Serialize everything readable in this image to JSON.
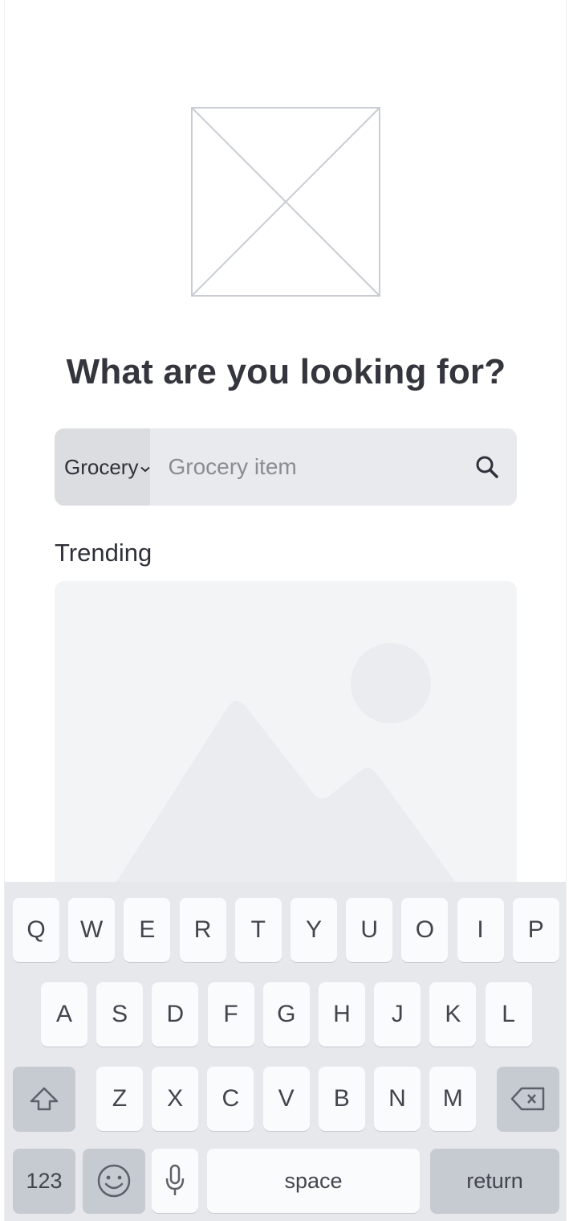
{
  "hero": {
    "icon": "image-placeholder-icon"
  },
  "title": "What are you looking for?",
  "search": {
    "category_label": "Grocery",
    "category_icon": "chevron-down-icon",
    "placeholder": "Grocery item",
    "value": "",
    "search_icon": "search-icon"
  },
  "trending": {
    "label": "Trending",
    "image_icon": "landscape-image-placeholder-icon"
  },
  "keyboard": {
    "row1": [
      "Q",
      "W",
      "E",
      "R",
      "T",
      "Y",
      "U",
      "O",
      "I",
      "P"
    ],
    "row2": [
      "A",
      "S",
      "D",
      "F",
      "G",
      "H",
      "J",
      "K",
      "L"
    ],
    "row3": [
      "Z",
      "X",
      "C",
      "V",
      "B",
      "N",
      "M"
    ],
    "numbers_label": "123",
    "space_label": "space",
    "return_label": "return"
  },
  "colors": {
    "background": "#ffffff",
    "search_bg": "#e9eaee",
    "category_bg": "#dcdde1",
    "keyboard_bg": "#e6e8ec",
    "key_bg": "#fafbfc",
    "key_dark_bg": "#c6cad1",
    "text": "#2f3039"
  }
}
